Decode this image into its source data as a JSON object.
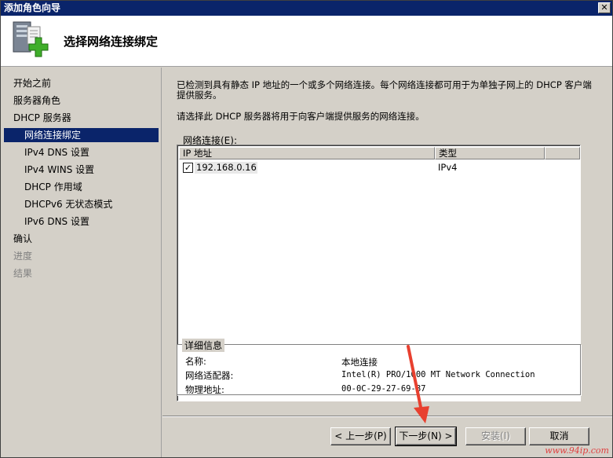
{
  "window": {
    "title": "添加角色向导",
    "close_glyph": "✕"
  },
  "header": {
    "title": "选择网络连接绑定",
    "icon": "server-add-icon"
  },
  "sidebar": {
    "items": [
      {
        "label": "开始之前",
        "level": 0,
        "state": "normal"
      },
      {
        "label": "服务器角色",
        "level": 0,
        "state": "normal"
      },
      {
        "label": "DHCP 服务器",
        "level": 0,
        "state": "normal"
      },
      {
        "label": "网络连接绑定",
        "level": 1,
        "state": "active"
      },
      {
        "label": "IPv4 DNS 设置",
        "level": 1,
        "state": "normal"
      },
      {
        "label": "IPv4 WINS 设置",
        "level": 1,
        "state": "normal"
      },
      {
        "label": "DHCP 作用域",
        "level": 1,
        "state": "normal"
      },
      {
        "label": "DHCPv6 无状态模式",
        "level": 1,
        "state": "normal"
      },
      {
        "label": "IPv6 DNS 设置",
        "level": 1,
        "state": "normal"
      },
      {
        "label": "确认",
        "level": 0,
        "state": "normal"
      },
      {
        "label": "进度",
        "level": 0,
        "state": "disabled"
      },
      {
        "label": "结果",
        "level": 0,
        "state": "disabled"
      }
    ]
  },
  "content": {
    "description": "已检测到具有静态 IP 地址的一个或多个网络连接。每个网络连接都可用于为单独子网上的 DHCP 客户端提供服务。",
    "prompt": "请选择此 DHCP 服务器将用于向客户端提供服务的网络连接。",
    "connections_label": "网络连接(E):",
    "columns": [
      "IP 地址",
      "类型"
    ],
    "rows": [
      {
        "checked": true,
        "ip": "192.168.0.16",
        "type": "IPv4"
      }
    ]
  },
  "details": {
    "legend": "详细信息",
    "fields": [
      {
        "label": "名称:",
        "value": "本地连接"
      },
      {
        "label": "网络适配器:",
        "value": "Intel(R) PRO/1000 MT Network Connection"
      },
      {
        "label": "物理地址:",
        "value": "00-0C-29-27-69-87"
      }
    ]
  },
  "buttons": {
    "back": "< 上一步(P)",
    "next": "下一步(N) >",
    "install": "安装(I)",
    "cancel": "取消"
  },
  "watermark": "www.94ip.com",
  "colors": {
    "titlebar": "#0a246a",
    "selection": "#0a246a",
    "face": "#d4d0c8",
    "arrow": "#e8402f"
  }
}
